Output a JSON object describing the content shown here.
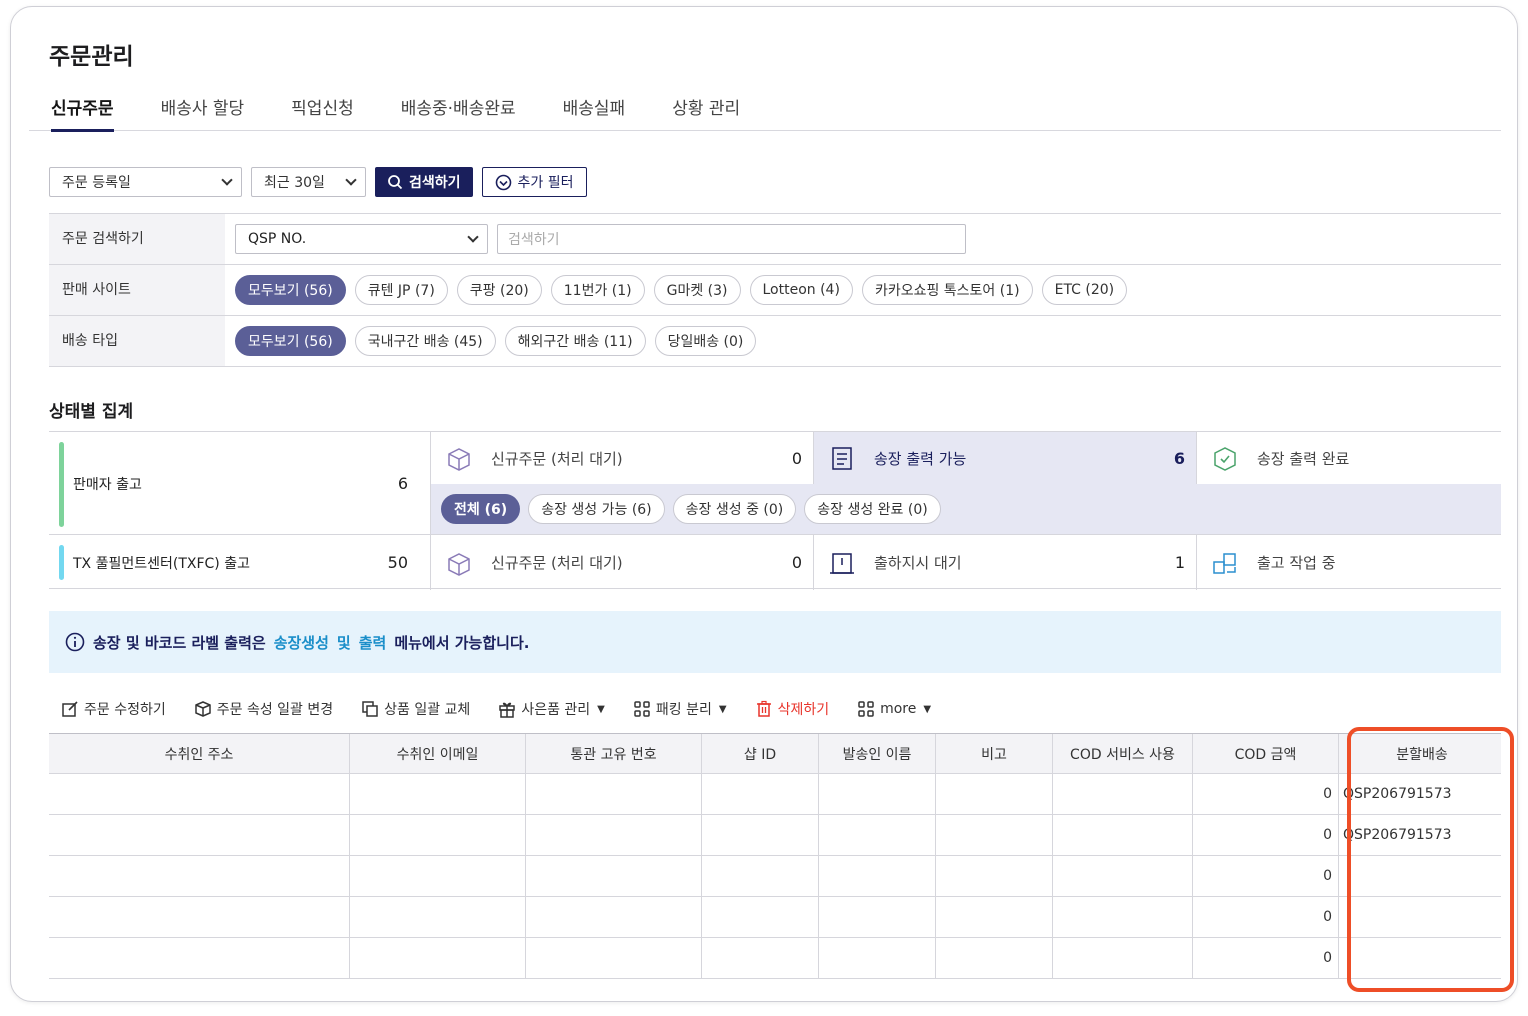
{
  "page": {
    "title": "주문관리"
  },
  "tabs": [
    {
      "label": "신규주문",
      "active": true
    },
    {
      "label": "배송사 할당",
      "active": false
    },
    {
      "label": "픽업신청",
      "active": false
    },
    {
      "label": "배송중·배송완료",
      "active": false
    },
    {
      "label": "배송실패",
      "active": false
    },
    {
      "label": "상황 관리",
      "active": false
    }
  ],
  "filters": {
    "date_type": "주문 등록일",
    "period": "최근 30일",
    "search_label": "검색하기",
    "extra_filter_label": "추가 필터"
  },
  "search": {
    "rows": {
      "order_search": "주문 검색하기",
      "sales_site": "판매 사이트",
      "delivery_type": "배송 타입"
    },
    "field_select": "QSP NO.",
    "input_placeholder": "검색하기",
    "site_chips": [
      "모두보기 (56)",
      "큐텐 JP (7)",
      "쿠팡 (20)",
      "11번가 (1)",
      "G마켓 (3)",
      "Lotteon (4)",
      "카카오쇼핑 톡스토어 (1)",
      "ETC (20)"
    ],
    "delivery_chips": [
      "모두보기 (56)",
      "국내구간 배송 (45)",
      "해외구간 배송 (11)",
      "당일배송 (0)"
    ]
  },
  "summary": {
    "title": "상태별 집계",
    "seller": {
      "name": "판매자 출고",
      "count": "6",
      "color": "#7ed39b"
    },
    "txfc": {
      "name": "TX 풀필먼트센터(TXFC) 출고",
      "count": "50",
      "color": "#73d8f0"
    },
    "seller_cells": [
      {
        "label": "신규주문 (처리 대기)",
        "count": "0",
        "icon": "package-icon"
      },
      {
        "label": "송장 출력 가능",
        "count": "6",
        "icon": "invoice-icon"
      },
      {
        "label": "송장 출력 완료",
        "count": "",
        "icon": "box-check-icon"
      }
    ],
    "sub_chips": [
      "전체 (6)",
      "송장 생성 가능 (6)",
      "송장 생성 중 (0)",
      "송장 생성 완료 (0)"
    ],
    "txfc_cells": [
      {
        "label": "신규주문 (처리 대기)",
        "count": "0",
        "icon": "package-icon"
      },
      {
        "label": "출하지시 대기",
        "count": "1",
        "icon": "clipboard-icon"
      },
      {
        "label": "출고 작업 중",
        "count": "",
        "icon": "boxes-icon"
      }
    ]
  },
  "notice": {
    "prefix": "송장 및 바코드 라벨 출력은",
    "link1": "송장생성",
    "and": "및",
    "link2": "출력",
    "suffix": "메뉴에서 가능합니다."
  },
  "toolbar": {
    "edit": "주문 수정하기",
    "bulk_attr": "주문 속성 일괄 변경",
    "bulk_replace": "상품 일괄 교체",
    "gift": "사은품 관리",
    "packing": "패킹 분리",
    "delete": "삭제하기",
    "more": "more"
  },
  "grid": {
    "columns": [
      "수취인 주소",
      "수취인 이메일",
      "통관 고유 번호",
      "샵 ID",
      "발송인 이름",
      "비고",
      "COD 서비스 사용",
      "COD 금액",
      "분할배송"
    ],
    "rows": [
      {
        "cod_amount": "0",
        "split": "QSP206791573"
      },
      {
        "cod_amount": "0",
        "split": "QSP206791573"
      },
      {
        "cod_amount": "0",
        "split": ""
      },
      {
        "cod_amount": "0",
        "split": ""
      },
      {
        "cod_amount": "0",
        "split": ""
      }
    ]
  },
  "colors": {
    "primary": "#1a1f5c",
    "chip_active": "#5b5f97",
    "highlight": "#ee4e27",
    "danger": "#e8342b",
    "link": "#1a8ec9"
  }
}
